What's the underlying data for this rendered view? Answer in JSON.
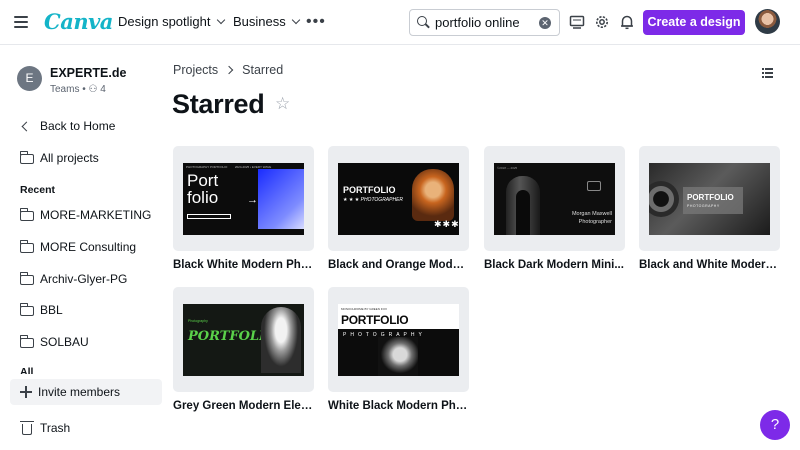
{
  "header": {
    "logo": "Canva",
    "nav": [
      {
        "label": "Design spotlight"
      },
      {
        "label": "Business"
      }
    ],
    "more": "•••",
    "search": {
      "value": "portfolio online",
      "placeholder": "Search"
    },
    "create_label": "Create a design",
    "accent_color": "#7d2ae8"
  },
  "sidebar": {
    "team": {
      "initial": "E",
      "name": "EXPERTE.de",
      "sub": "Teams • ⚇ 4"
    },
    "back_label": "Back to Home",
    "all_projects_label": "All projects",
    "recent_label": "Recent",
    "recent": [
      "MORE-MARKETING",
      "MORE Consulting",
      "Archiv-Glyer-PG",
      "BBL",
      "SOLBAU"
    ],
    "all_label": "All",
    "invite_label": "Invite members",
    "trash_label": "Trash"
  },
  "main": {
    "breadcrumb": [
      "Projects",
      "Starred"
    ],
    "title": "Starred",
    "cards": [
      {
        "title": "Black White Modern Pho...",
        "thumb": {
          "w1": "Port",
          "w2": "folio",
          "arrow": "→"
        }
      },
      {
        "title": "Black and Orange Moder...",
        "thumb": {
          "w1": "PORTFOLIO",
          "w2": "★ ★ ★  PHOTOGRAPHER",
          "stars": "✱✱✱"
        }
      },
      {
        "title": "Black Dark Modern Mini...",
        "thumb": {
          "tiny": "©2018 — 2025",
          "name1": "Morgan Maxwell",
          "name2": "Photographer"
        }
      },
      {
        "title": "Black and White Modern ...",
        "thumb": {
          "w1": "PORTFOLIO",
          "w2": "PHOTOGRAPHY"
        }
      },
      {
        "title": "Grey Green Modern Eleg...",
        "thumb": {
          "tiny": "Photography",
          "w1": "PORTFOLIO"
        }
      },
      {
        "title": "White Black Modern Pho...",
        "thumb": {
          "tiny": "MONOCHROME          BY GREEN FOX",
          "w1": "PORTFOLIO",
          "w2": "PHOTOGRAPHY"
        }
      }
    ]
  },
  "help_label": "?"
}
